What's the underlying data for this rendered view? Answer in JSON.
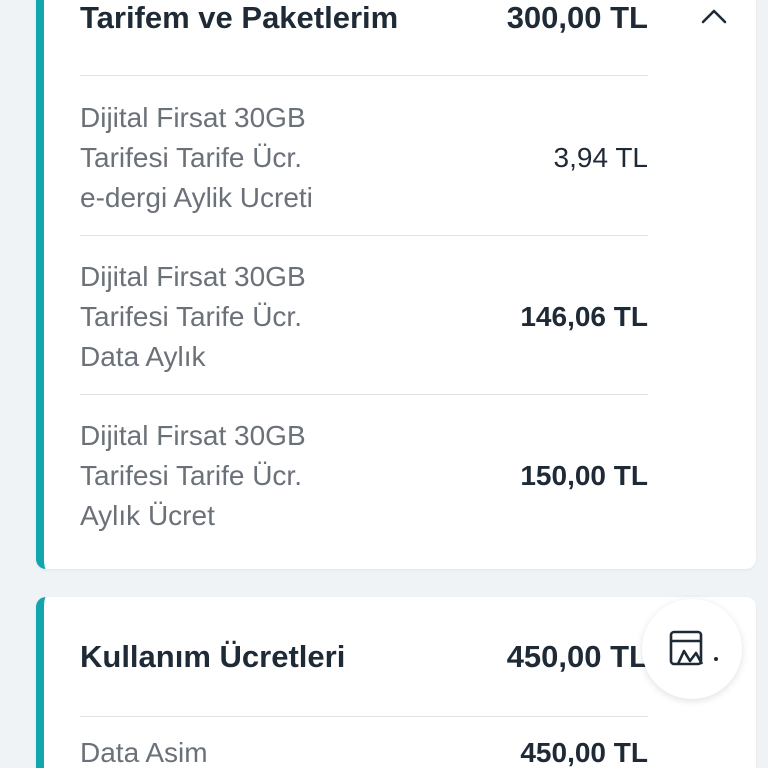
{
  "tariff_section": {
    "title": "Tarifem ve Paketlerim",
    "amount": "300,00 TL",
    "toggle_icon": "chevron-up-icon",
    "items": [
      {
        "label_lines": [
          "Dijital Firsat 30GB",
          "Tarifesi Tarife Ücr.",
          "e-dergi Aylik Ucreti"
        ],
        "amount": "3,94 TL"
      },
      {
        "label_lines": [
          "Dijital Firsat 30GB",
          "Tarifesi Tarife Ücr.",
          "Data Aylık"
        ],
        "amount": "146,06 TL"
      },
      {
        "label_lines": [
          "Dijital Firsat 30GB",
          "Tarifesi Tarife Ücr.",
          "Aylık Ücret"
        ],
        "amount": "150,00 TL"
      }
    ]
  },
  "usage_section": {
    "title": "Kullanım Ücretleri",
    "amount": "450,00 TL",
    "items": [
      {
        "label": "Data Asim",
        "amount": "450,00 TL"
      }
    ]
  },
  "floating_button": {
    "icon": "bill-icon"
  },
  "colors": {
    "accent": "#11a6ad",
    "text_dark": "#1f2a37",
    "text_muted": "#6b7178",
    "divider": "#dfe3e6",
    "background": "#f0f3f5"
  }
}
